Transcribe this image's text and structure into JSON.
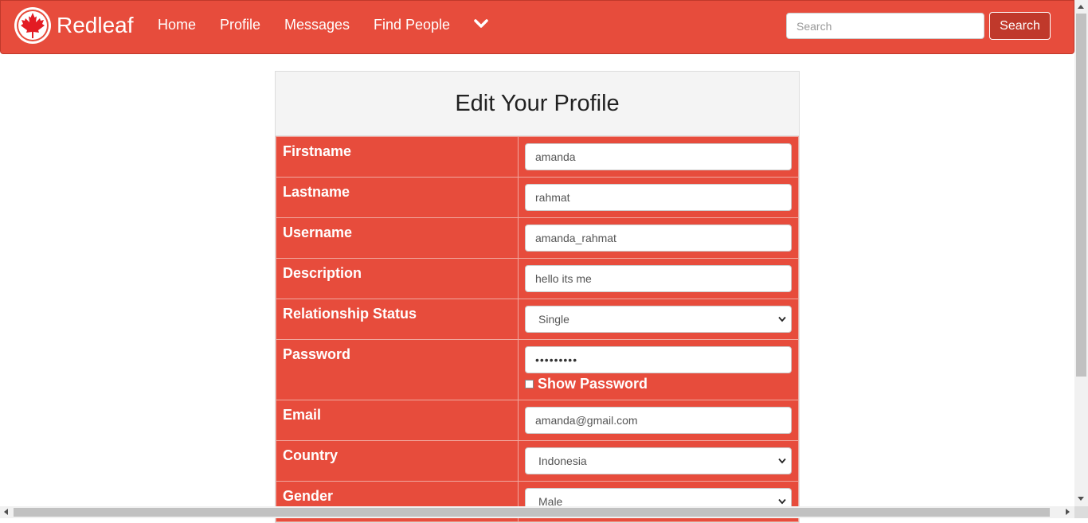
{
  "brand": {
    "name": "Redleaf",
    "logo": "maple-leaf-icon"
  },
  "nav": {
    "links": [
      "Home",
      "Profile",
      "Messages",
      "Find People"
    ],
    "more_icon": "chevron-down-icon",
    "search": {
      "placeholder": "Search",
      "value": "",
      "button_label": "Search"
    }
  },
  "panel": {
    "title": "Edit Your Profile",
    "fields": [
      {
        "label": "Firstname",
        "type": "text",
        "value": "amanda"
      },
      {
        "label": "Lastname",
        "type": "text",
        "value": "rahmat"
      },
      {
        "label": "Username",
        "type": "text",
        "value": "amanda_rahmat"
      },
      {
        "label": "Description",
        "type": "text",
        "value": "hello its me"
      },
      {
        "label": "Relationship Status",
        "type": "select",
        "value": "Single"
      },
      {
        "label": "Password",
        "type": "password",
        "value": "•••••••••"
      },
      {
        "label": "Email",
        "type": "text",
        "value": "amanda@gmail.com"
      },
      {
        "label": "Country",
        "type": "select",
        "value": "Indonesia"
      },
      {
        "label": "Gender",
        "type": "select",
        "value": "Male"
      }
    ],
    "show_password_label": "Show Password"
  },
  "colors": {
    "primary": "#e74c3c",
    "primary_dark": "#c0392b",
    "heading_bg": "#f4f4f4"
  }
}
